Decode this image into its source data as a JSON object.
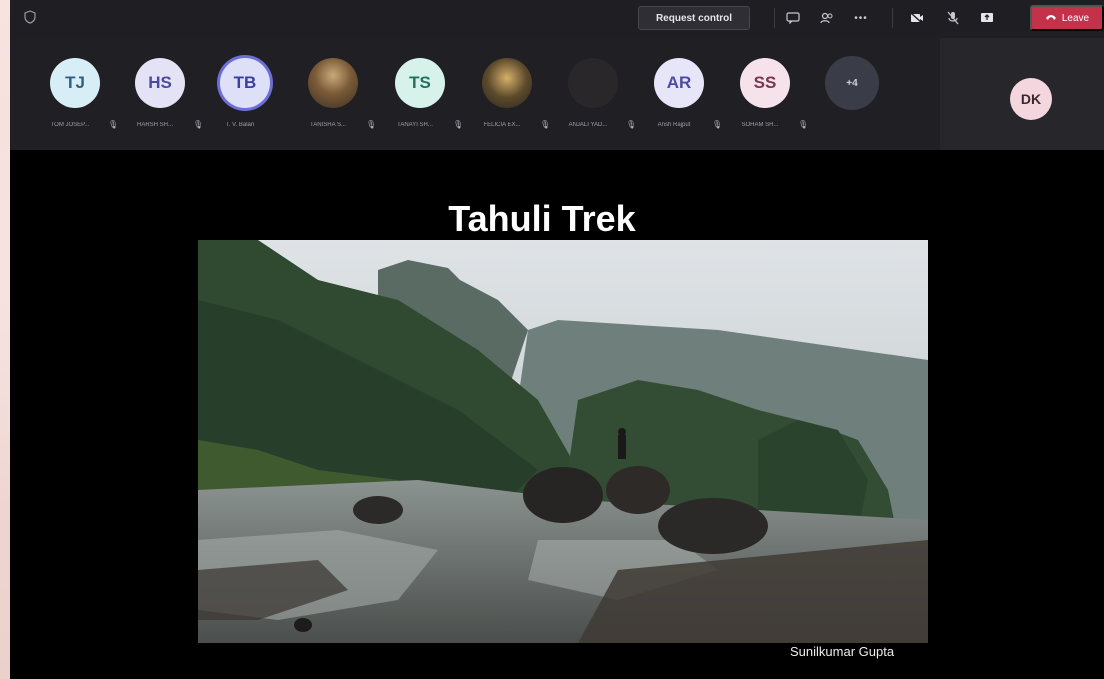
{
  "toolbar": {
    "request_control_label": "Request control",
    "leave_label": "Leave",
    "more_label": "•••"
  },
  "participants": [
    {
      "initials": "TJ",
      "name": "TOM JOSEP...",
      "bg": "#d8eef7",
      "fg": "#2f5f85"
    },
    {
      "initials": "HS",
      "name": "HARSH SH...",
      "bg": "#e4e3f6",
      "fg": "#4b4aa0"
    },
    {
      "initials": "TB",
      "name": "T. V. Balan",
      "bg": "#dde0f6",
      "fg": "#3b3f9e"
    },
    {
      "initials": "",
      "name": "TANISHA S...",
      "photo": true
    },
    {
      "initials": "TS",
      "name": "TANAYI SH...",
      "bg": "#d6f2ea",
      "fg": "#1f7360"
    },
    {
      "initials": "",
      "name": "FELICIA EX...",
      "photo": true
    },
    {
      "initials": "",
      "name": "ANJALI YAD...",
      "dark": true
    },
    {
      "initials": "AR",
      "name": "Ansh Rajput",
      "bg": "#e6e6f8",
      "fg": "#4c4ba5"
    },
    {
      "initials": "SS",
      "name": "SOHAM SH...",
      "bg": "#f6e2ea",
      "fg": "#7a3550"
    },
    {
      "initials": "+4",
      "name": "",
      "overflow": true
    }
  ],
  "self_view": {
    "initials": "DK"
  },
  "slide": {
    "title": "Tahuli Trek",
    "credit": "Sunilkumar Gupta"
  },
  "colors": {
    "leave": "#c4314b",
    "active_ring": "#6c6fd8"
  }
}
